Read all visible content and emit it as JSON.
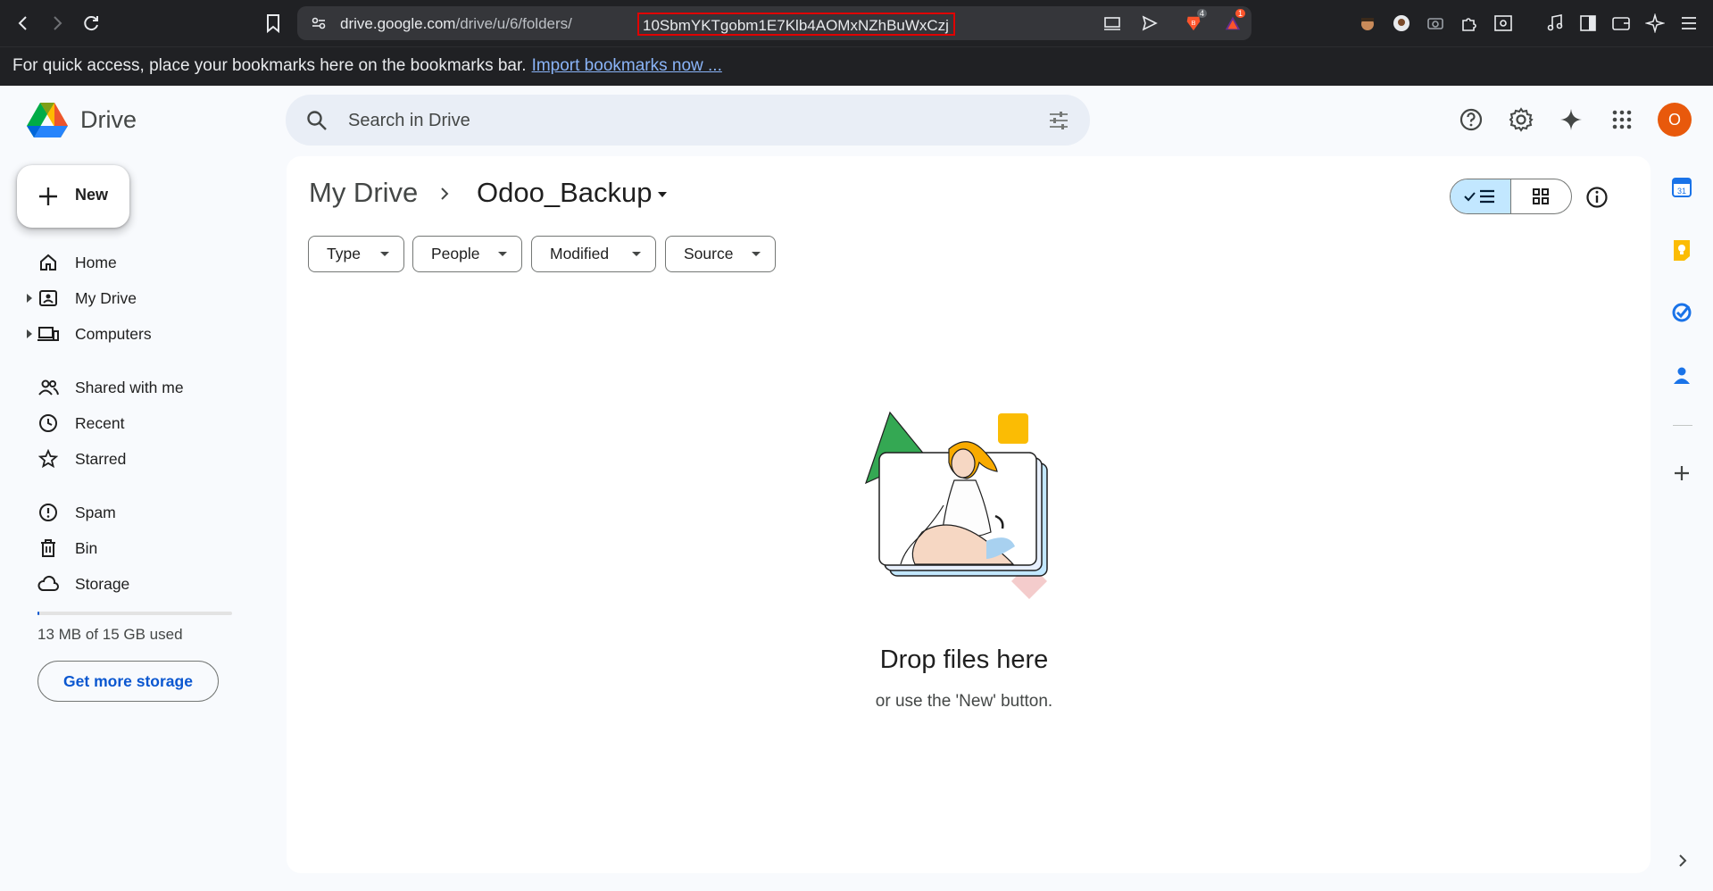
{
  "browser": {
    "url_host": "drive.google.com",
    "url_path": "/drive/u/6/folders/",
    "url_folder_id": "10SbmYKTgobm1E7Klb4AOMxNZhBuWxCzj",
    "brave_shield_count": "4",
    "rewards_count": "1",
    "bookmarks_prompt": "For quick access, place your bookmarks here on the bookmarks bar.",
    "bookmarks_link": "Import bookmarks now ..."
  },
  "header": {
    "app_name": "Drive",
    "search_placeholder": "Search in Drive",
    "avatar_initial": "O"
  },
  "sidebar": {
    "new_label": "New",
    "items": [
      {
        "label": "Home",
        "icon": "home-icon"
      },
      {
        "label": "My Drive",
        "icon": "my-drive-icon"
      },
      {
        "label": "Computers",
        "icon": "computers-icon"
      },
      {
        "label": "Shared with me",
        "icon": "shared-icon"
      },
      {
        "label": "Recent",
        "icon": "recent-icon"
      },
      {
        "label": "Starred",
        "icon": "star-icon"
      },
      {
        "label": "Spam",
        "icon": "spam-icon"
      },
      {
        "label": "Bin",
        "icon": "bin-icon"
      },
      {
        "label": "Storage",
        "icon": "cloud-icon"
      }
    ],
    "storage_used_fraction": 0.001,
    "storage_text": "13 MB of 15 GB used",
    "get_more_storage": "Get more storage"
  },
  "main": {
    "breadcrumb_root": "My Drive",
    "breadcrumb_current": "Odoo_Backup",
    "filters": [
      "Type",
      "People",
      "Modified",
      "Source"
    ],
    "empty_title": "Drop files here",
    "empty_subtitle": "or use the 'New' button."
  },
  "colors": {
    "accent": "#0b57d0",
    "avatar": "#e8590c",
    "view_selected": "#c2e7ff",
    "url_highlight": "#e00000"
  }
}
